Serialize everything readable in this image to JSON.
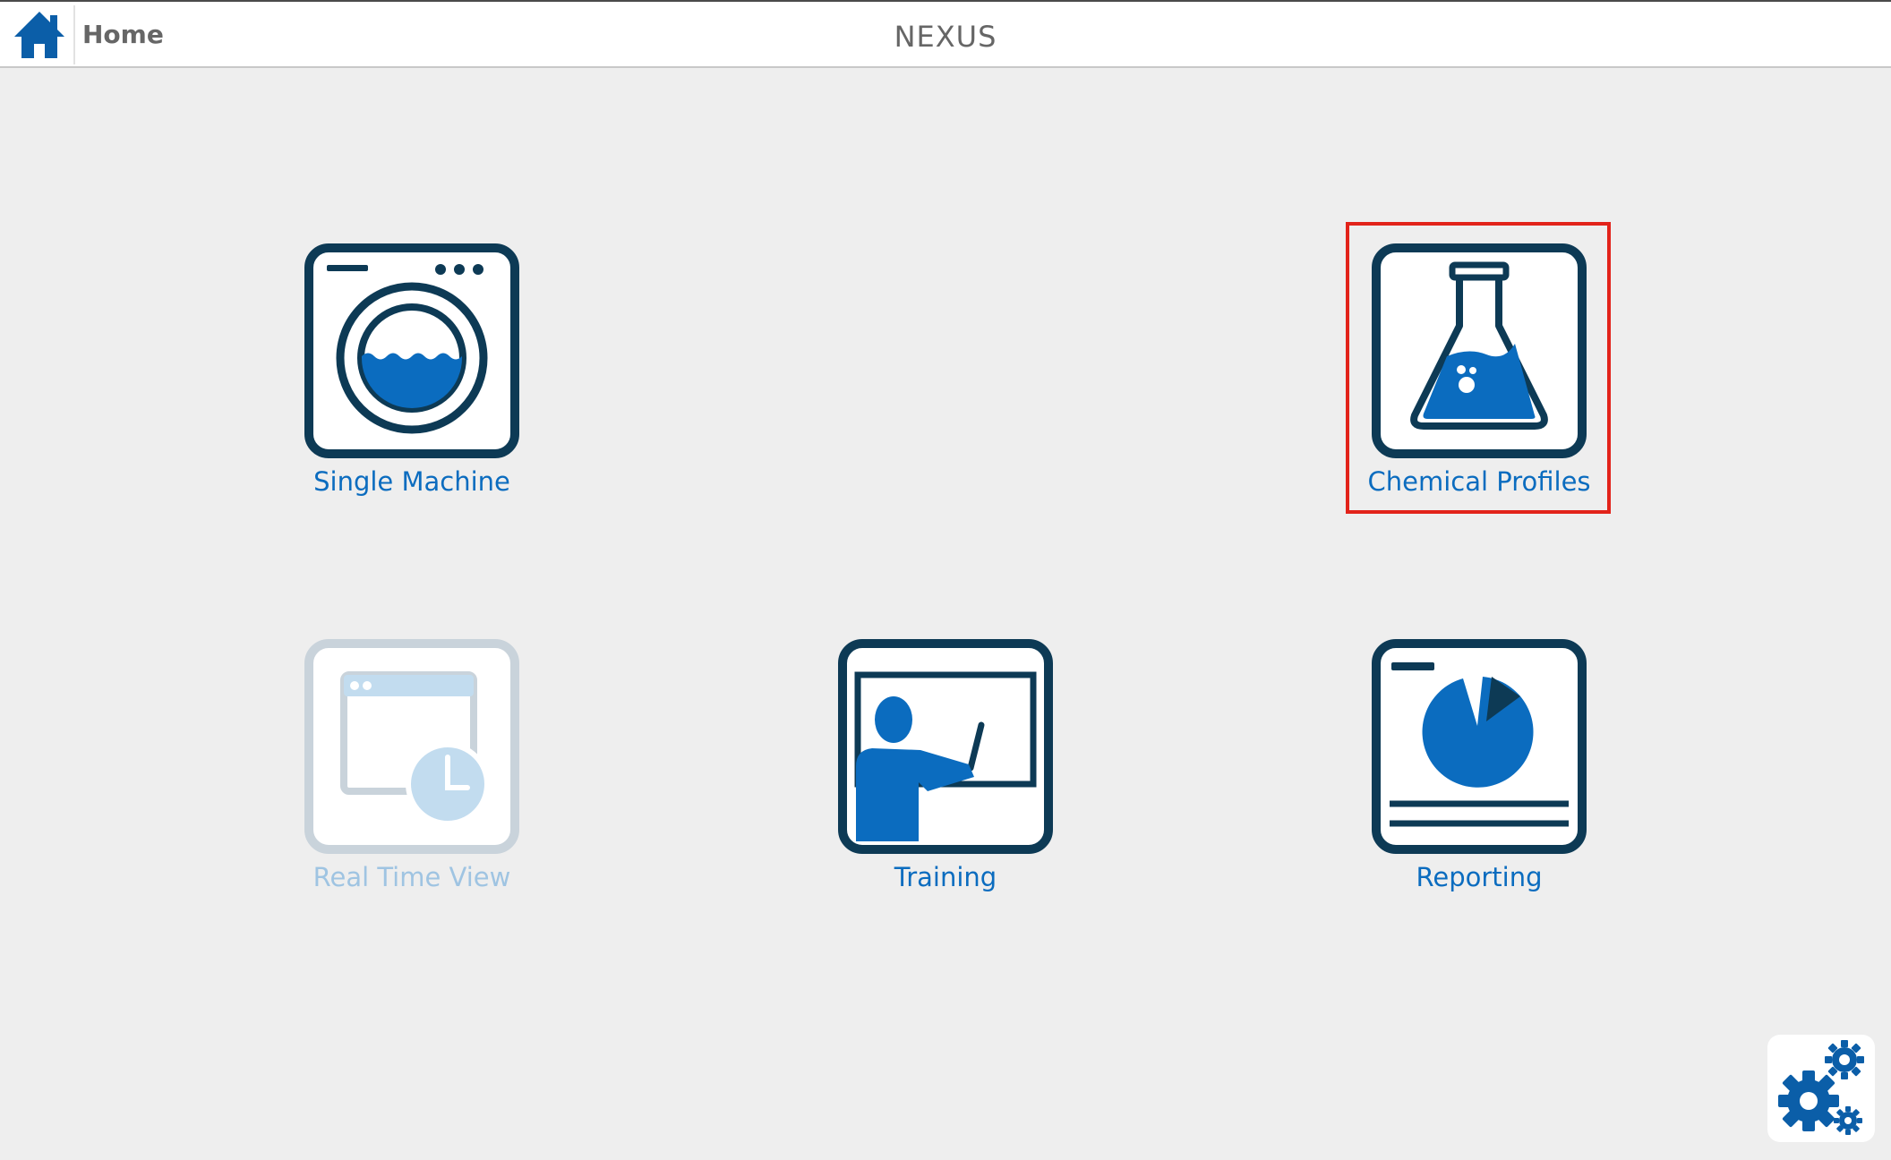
{
  "header": {
    "home_label": "Home",
    "app_title": "NEXUS"
  },
  "tiles": [
    {
      "label": "Single Machine",
      "icon": "washing-machine-icon",
      "enabled": true
    },
    {
      "label": "Chemical Profiles",
      "icon": "chemical-flask-icon",
      "enabled": true,
      "selected": true
    },
    {
      "label": "Real Time View",
      "icon": "real-time-clock-icon",
      "enabled": false
    },
    {
      "label": "Training",
      "icon": "training-presenter-icon",
      "enabled": true
    },
    {
      "label": "Reporting",
      "icon": "reporting-chart-icon",
      "enabled": true
    }
  ],
  "footer": {
    "settings_icon": "gears-icon"
  },
  "colors": {
    "navy": "#0d3a55",
    "blue": "#0b6cbf",
    "disabled_blue": "#9fc4e2",
    "disabled_border": "#c9d3db",
    "highlight": "#e2231a",
    "background": "#eeeeee"
  }
}
